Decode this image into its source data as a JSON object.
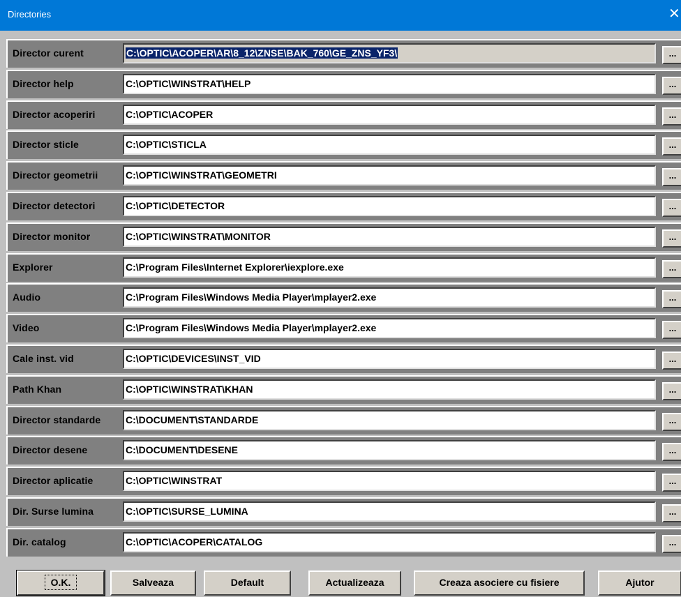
{
  "window": {
    "title": "Directories",
    "close_label": "✕"
  },
  "rows": [
    {
      "label": "Director curent",
      "value": "C:\\OPTIC\\ACOPER\\AR\\8_12\\ZNSE\\BAK_760\\GE_ZNS_YF3\\",
      "selected": true
    },
    {
      "label": "Director help",
      "value": "C:\\OPTIC\\WINSTRAT\\HELP"
    },
    {
      "label": "Director acoperiri",
      "value": "C:\\OPTIC\\ACOPER"
    },
    {
      "label": "Director sticle",
      "value": "C:\\OPTIC\\STICLA"
    },
    {
      "label": "Director geometrii",
      "value": "C:\\OPTIC\\WINSTRAT\\GEOMETRI"
    },
    {
      "label": "Director detectori",
      "value": "C:\\OPTIC\\DETECTOR"
    },
    {
      "label": "Director monitor",
      "value": "C:\\OPTIC\\WINSTRAT\\MONITOR"
    },
    {
      "label": "Explorer",
      "value": "C:\\Program Files\\Internet Explorer\\iexplore.exe"
    },
    {
      "label": "Audio",
      "value": "C:\\Program Files\\Windows Media Player\\mplayer2.exe"
    },
    {
      "label": "Video",
      "value": "C:\\Program Files\\Windows Media Player\\mplayer2.exe"
    },
    {
      "label": "Cale inst. vid",
      "value": "C:\\OPTIC\\DEVICES\\INST_VID"
    },
    {
      "label": "Path Khan",
      "value": "C:\\OPTIC\\WINSTRAT\\KHAN"
    },
    {
      "label": "Director standarde",
      "value": "C:\\DOCUMENT\\STANDARDE"
    },
    {
      "label": "Director desene",
      "value": "C:\\DOCUMENT\\DESENE"
    },
    {
      "label": "Director aplicatie",
      "value": "C:\\OPTIC\\WINSTRAT"
    },
    {
      "label": "Dir. Surse lumina",
      "value": "C:\\OPTIC\\SURSE_LUMINA"
    },
    {
      "label": "Dir. catalog",
      "value": "C:\\OPTIC\\ACOPER\\CATALOG"
    }
  ],
  "browse_label": "...",
  "buttons": {
    "ok": "O.K.",
    "save": "Salveaza",
    "default": "Default",
    "update": "Actualizeaza",
    "associate": "Creaza asociere cu fisiere",
    "help": "Ajutor"
  }
}
